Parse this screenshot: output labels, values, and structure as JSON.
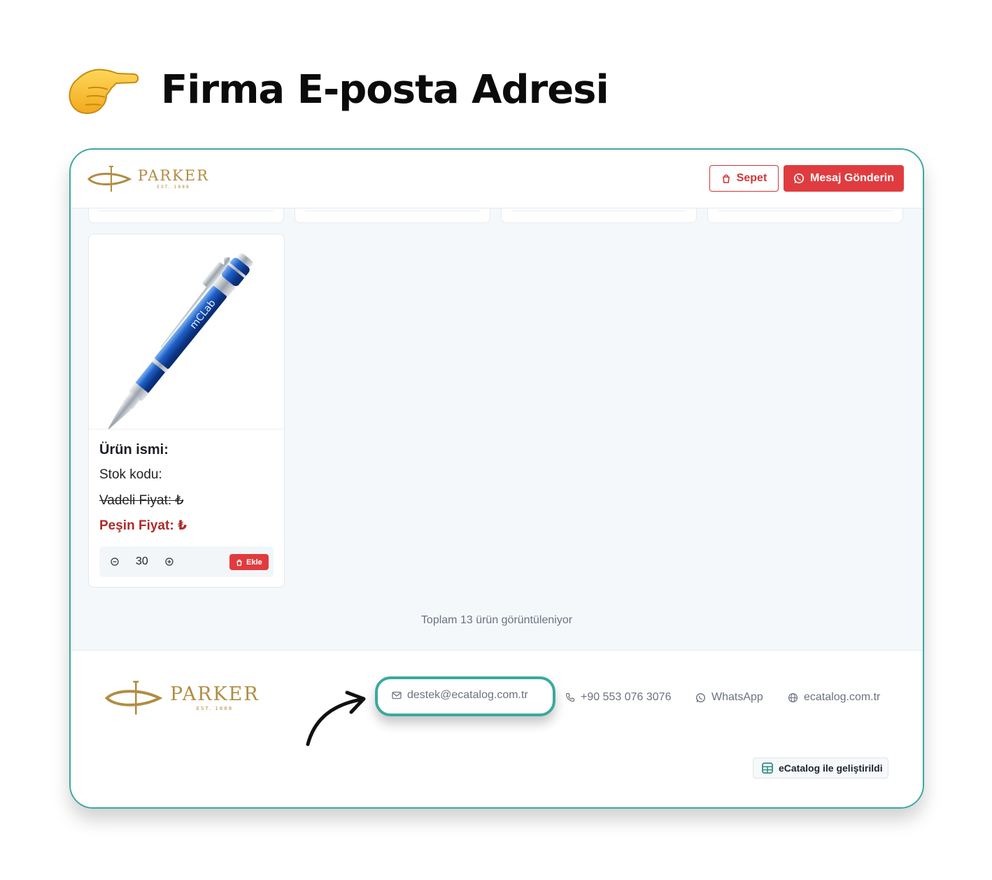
{
  "headline": {
    "icon": "pointing-hand-icon",
    "title": "Firma E-posta Adresi"
  },
  "brand": {
    "name": "PARKER",
    "est": "EST. 1888",
    "colors": {
      "gold": "#b08d43"
    }
  },
  "header": {
    "cart_label": "Sepet",
    "message_label": "Mesaj Gönderin"
  },
  "product": {
    "name_label": "Ürün ismi:",
    "stock_label": "Stok kodu:",
    "term_price_label": "Vadeli Fiyat: ₺",
    "cash_price_label": "Peşin Fiyat: ₺",
    "quantity": "30",
    "add_label": "Ekle",
    "image_text": "mCLab"
  },
  "total_text": "Toplam 13 ürün görüntüleniyor",
  "footer": {
    "email": "destek@ecatalog.com.tr",
    "phone": "+90 553 076 3076",
    "whatsapp": "WhatsApp",
    "website": "ecatalog.com.tr",
    "badge": "eCatalog ile geliştirildi"
  },
  "colors": {
    "accent": "#3aa99e",
    "primary_red": "#e03c3f",
    "price_red": "#b02a2a"
  }
}
